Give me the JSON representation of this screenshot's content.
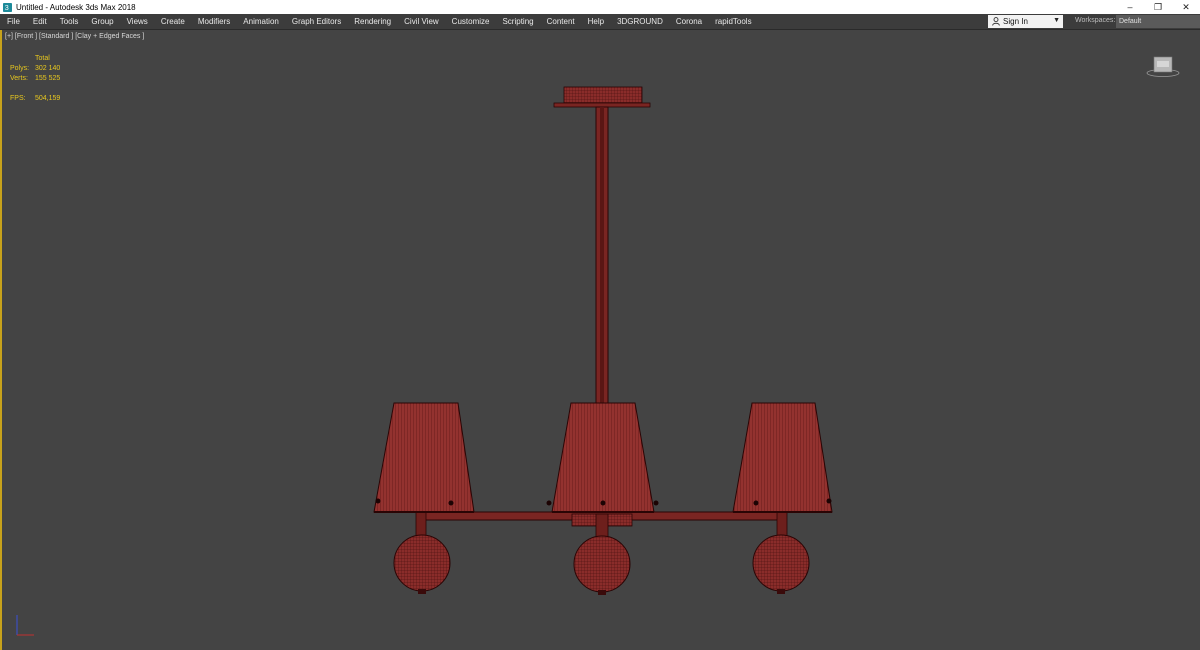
{
  "window": {
    "title": "Untitled - Autodesk 3ds Max 2018",
    "icon": "3dsmax-icon",
    "controls": {
      "minimize": "–",
      "restore": "❐",
      "close": "✕"
    }
  },
  "menubar": {
    "items": [
      "File",
      "Edit",
      "Tools",
      "Group",
      "Views",
      "Create",
      "Modifiers",
      "Animation",
      "Graph Editors",
      "Rendering",
      "Civil View",
      "Customize",
      "Scripting",
      "Content",
      "Help",
      "3DGROUND",
      "Corona",
      "rapidTools"
    ],
    "signin": "Sign In",
    "workspaces_label": "Workspaces:",
    "workspace_value": "Default"
  },
  "viewport": {
    "label": "[+] [Front ] [Standard ] [Clay + Edged Faces ]",
    "stats": {
      "header": "Total",
      "polys_label": "Polys:",
      "polys_value": "302 140",
      "verts_label": "Verts:",
      "verts_value": "155 525",
      "fps_label": "FPS:",
      "fps_value": "504,159"
    },
    "accent_color": "#c7a21b",
    "mesh_color": "#8c2f2c",
    "wire_color": "#3a0a0a"
  }
}
